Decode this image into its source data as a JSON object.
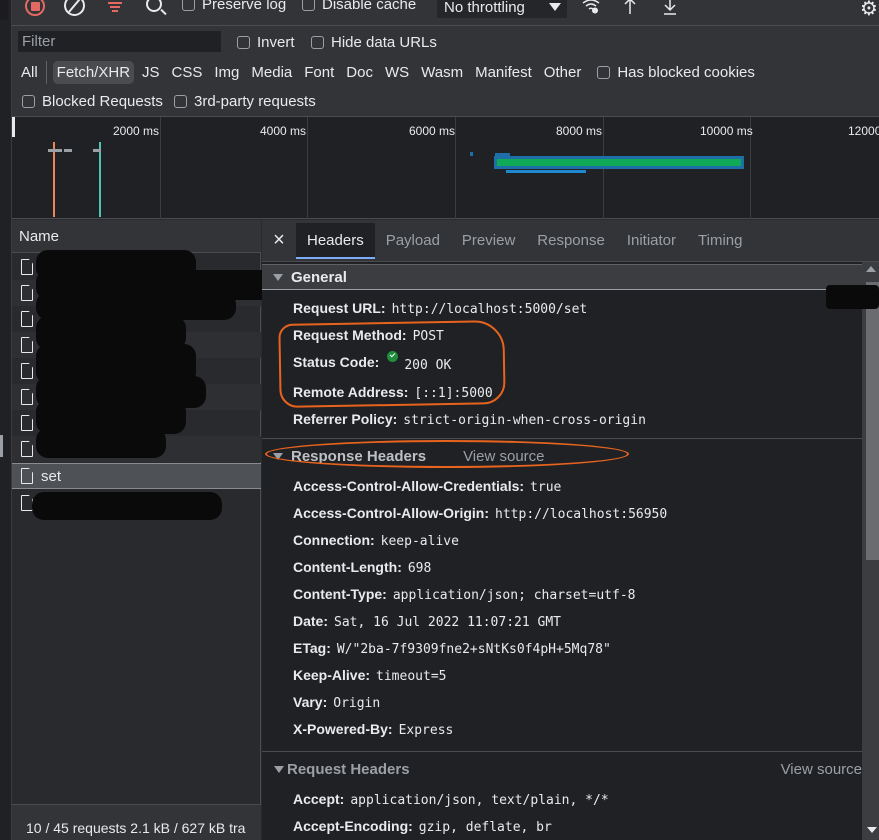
{
  "toolbar": {
    "record_icon": "record-stop-icon",
    "clear_icon": "clear-icon",
    "filter_icon": "filter-icon",
    "search_icon": "search-icon",
    "preserve_log": {
      "label": "Preserve log",
      "checked": false
    },
    "disable_cache": {
      "label": "Disable cache",
      "checked": false
    },
    "throttling": {
      "selected": "No throttling"
    },
    "network_conditions_icon": "wifi-gear-icon",
    "import_icon": "upload-arrow-icon",
    "export_icon": "download-arrow-icon",
    "settings_icon": "gear-icon"
  },
  "filters": {
    "filter_placeholder": "Filter",
    "filter_value": "",
    "invert": {
      "label": "Invert",
      "checked": false
    },
    "hide_data_urls": {
      "label": "Hide data URLs",
      "checked": false
    },
    "types": [
      {
        "label": "All",
        "active": false
      },
      {
        "label": "Fetch/XHR",
        "active": true
      },
      {
        "label": "JS",
        "active": false
      },
      {
        "label": "CSS",
        "active": false
      },
      {
        "label": "Img",
        "active": false
      },
      {
        "label": "Media",
        "active": false
      },
      {
        "label": "Font",
        "active": false
      },
      {
        "label": "Doc",
        "active": false
      },
      {
        "label": "WS",
        "active": false
      },
      {
        "label": "Wasm",
        "active": false
      },
      {
        "label": "Manifest",
        "active": false
      },
      {
        "label": "Other",
        "active": false
      }
    ],
    "has_blocked_cookies": {
      "label": "Has blocked cookies",
      "checked": false
    },
    "blocked_requests": {
      "label": "Blocked Requests",
      "checked": false
    },
    "third_party": {
      "label": "3rd-party requests",
      "checked": false
    }
  },
  "overview": {
    "ticks": [
      "2000 ms",
      "4000 ms",
      "6000 ms",
      "8000 ms",
      "10000 ms",
      "12000"
    ],
    "colors": {
      "dom_content_loaded": "#e8865a",
      "load": "#4fc3b8",
      "waiting": "#1e6fa8",
      "receiving": "#0fa958"
    }
  },
  "requests": {
    "column_name": "Name",
    "rows": [
      {
        "name": "",
        "redacted": true
      },
      {
        "name": "",
        "redacted": true
      },
      {
        "name": "",
        "redacted": true
      },
      {
        "name": "",
        "redacted": true
      },
      {
        "name": "",
        "redacted": true
      },
      {
        "name": "",
        "redacted": true
      },
      {
        "name": "",
        "redacted": true
      },
      {
        "name": "",
        "redacted": true
      },
      {
        "name": "set",
        "redacted": false,
        "selected": true
      },
      {
        "name": "",
        "redacted": true
      }
    ],
    "status": "10 / 45 requests  2.1 kB / 627 kB tra"
  },
  "detail": {
    "close_label": "×",
    "tabs": [
      {
        "label": "Headers",
        "active": true
      },
      {
        "label": "Payload",
        "active": false
      },
      {
        "label": "Preview",
        "active": false
      },
      {
        "label": "Response",
        "active": false
      },
      {
        "label": "Initiator",
        "active": false
      },
      {
        "label": "Timing",
        "active": false
      }
    ],
    "general": {
      "title": "General",
      "items": [
        {
          "key": "Request URL:",
          "value": "http://localhost:5000/set"
        },
        {
          "key": "Request Method:",
          "value": "POST"
        },
        {
          "key": "Status Code:",
          "value": "200 OK",
          "status_icon": "check-circle-icon",
          "status_color": "#1e8e3e"
        },
        {
          "key": "Remote Address:",
          "value": "[::1]:5000"
        },
        {
          "key": "Referrer Policy:",
          "value": "strict-origin-when-cross-origin"
        }
      ]
    },
    "response_headers": {
      "title": "Response Headers",
      "view_source": "View source",
      "items": [
        {
          "key": "Access-Control-Allow-Credentials:",
          "value": "true"
        },
        {
          "key": "Access-Control-Allow-Origin:",
          "value": "http://localhost:56950"
        },
        {
          "key": "Connection:",
          "value": "keep-alive"
        },
        {
          "key": "Content-Length:",
          "value": "698"
        },
        {
          "key": "Content-Type:",
          "value": "application/json; charset=utf-8"
        },
        {
          "key": "Date:",
          "value": "Sat, 16 Jul 2022 11:07:21 GMT"
        },
        {
          "key": "ETag:",
          "value": "W/\"2ba-7f9309fne2+sNtKs0f4pH+5Mq78\""
        },
        {
          "key": "Keep-Alive:",
          "value": "timeout=5"
        },
        {
          "key": "Vary:",
          "value": "Origin"
        },
        {
          "key": "X-Powered-By:",
          "value": "Express"
        }
      ]
    },
    "request_headers": {
      "title": "Request Headers",
      "view_source": "View source",
      "items": [
        {
          "key": "Accept:",
          "value": "application/json, text/plain, */*"
        },
        {
          "key": "Accept-Encoding:",
          "value": "gzip, deflate, br"
        }
      ]
    }
  },
  "annotation_color": "#e8641e"
}
